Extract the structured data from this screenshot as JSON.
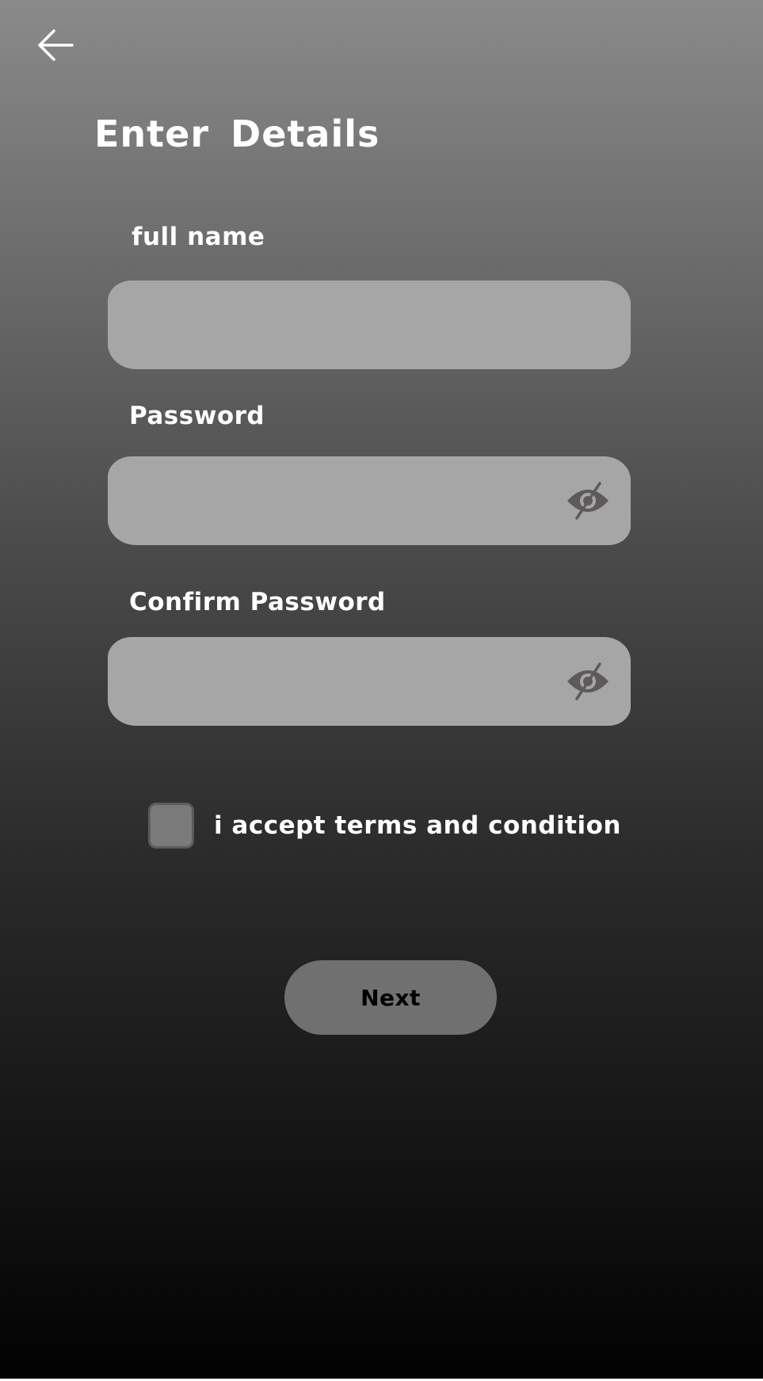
{
  "header": {
    "back_icon": "arrow-left-icon",
    "title": "Enter  Details"
  },
  "form": {
    "full_name": {
      "label": "full name",
      "value": "",
      "placeholder": ""
    },
    "password": {
      "label": "Password",
      "value": "",
      "placeholder": "",
      "toggle_icon": "eye-slash-icon"
    },
    "confirm_password": {
      "label": "Confirm Password",
      "value": "",
      "placeholder": "",
      "toggle_icon": "eye-slash-icon"
    },
    "terms": {
      "label": "i accept terms and condition",
      "checked": false
    },
    "next_label": "Next"
  },
  "colors": {
    "gradient_top": "#8a8a8a",
    "gradient_bottom": "#020202",
    "field_bg": "#a6a6a6",
    "icon": "#5f5a5a",
    "button_bg": "#707070",
    "text": "#ffffff"
  }
}
